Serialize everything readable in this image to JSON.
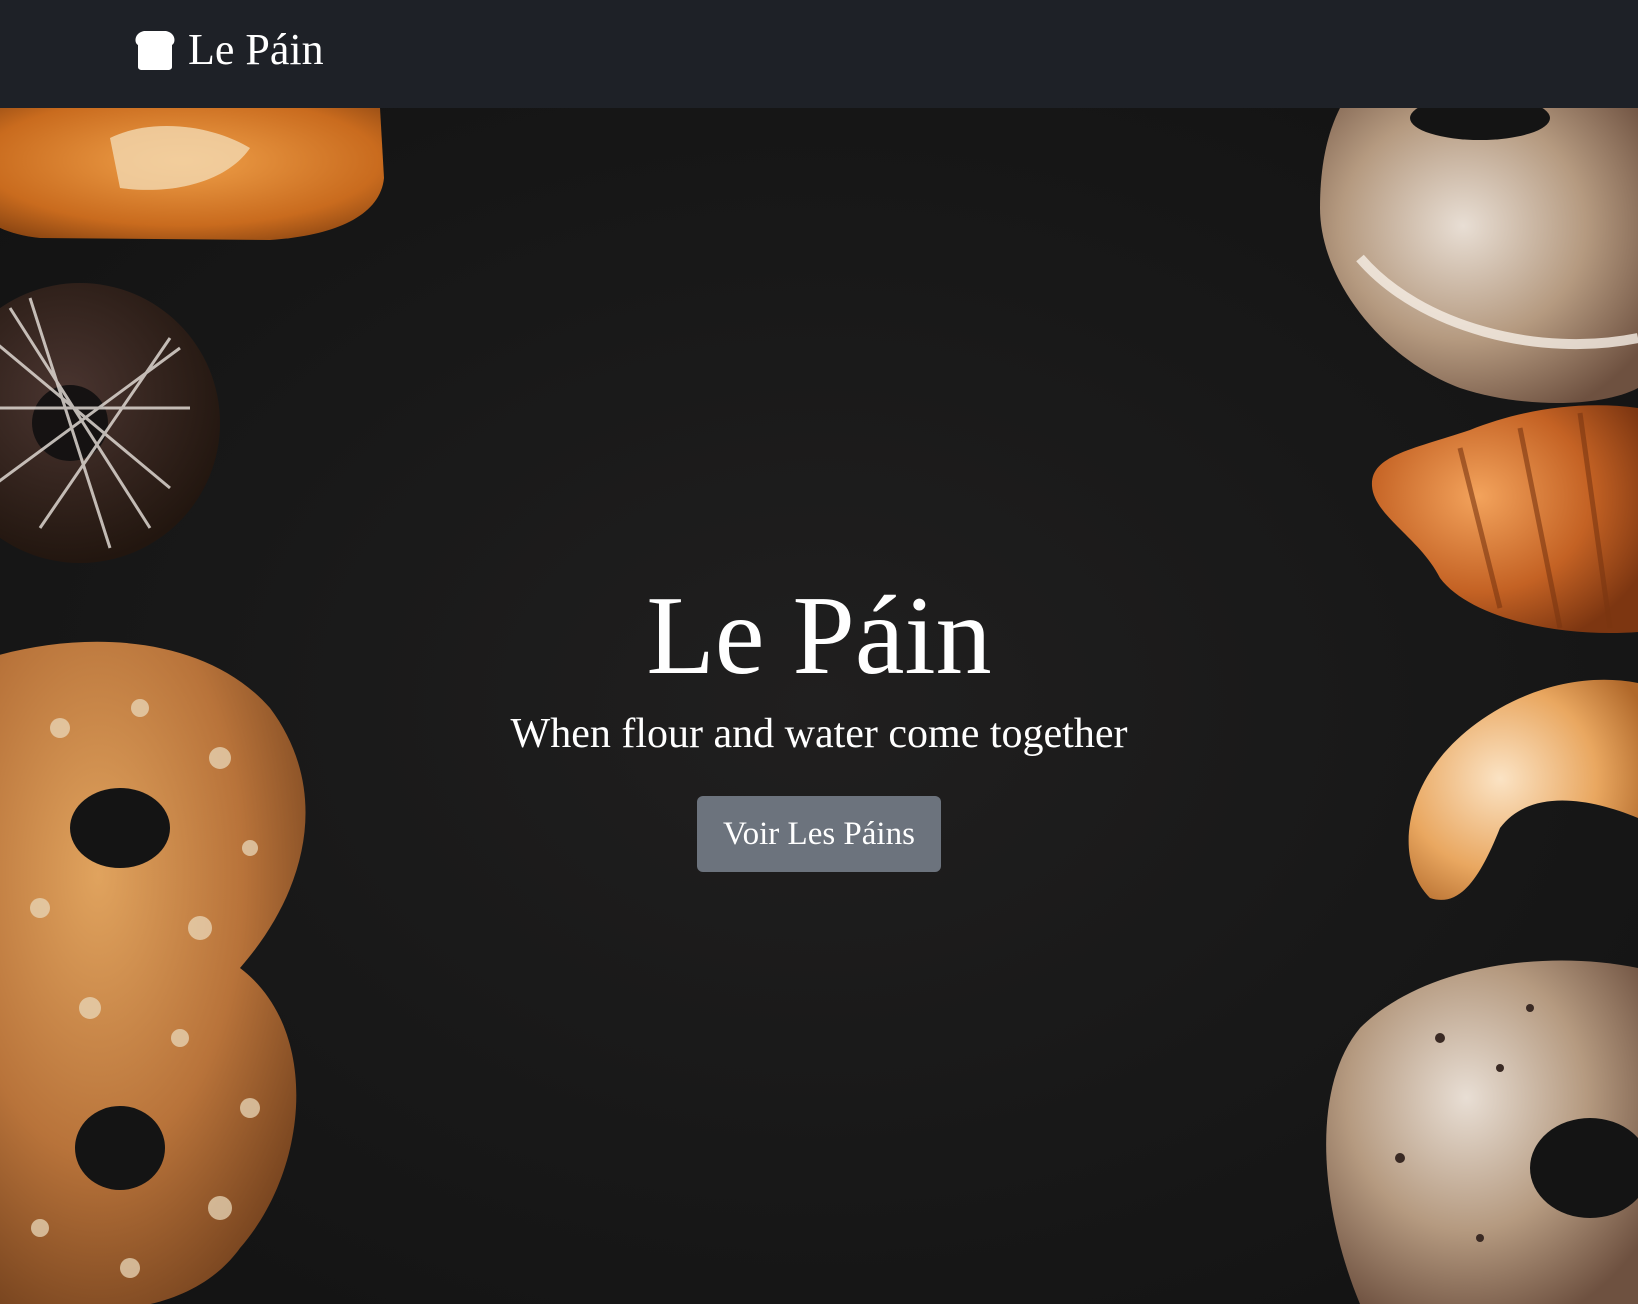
{
  "navbar": {
    "brand_icon": "bread-loaf-icon",
    "brand_text": "Le Páin"
  },
  "hero": {
    "title": "Le Páin",
    "subtitle": "When flour and water come together",
    "button_label": "Voir Les Páins"
  },
  "colors": {
    "navbar_bg": "#1e2127",
    "hero_bg": "#171718",
    "button_bg": "#6c737d",
    "text": "#ffffff"
  }
}
